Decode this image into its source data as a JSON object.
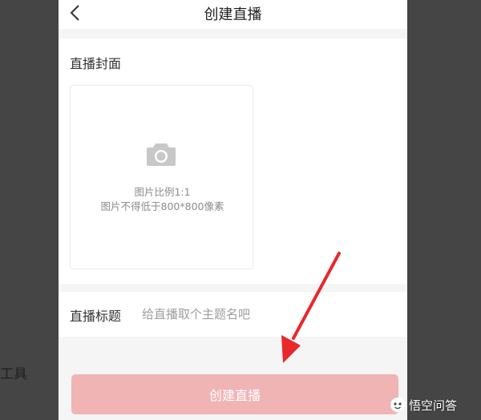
{
  "background": {
    "left_text": "工具"
  },
  "nav": {
    "title": "创建直播",
    "back_icon": "chevron-left-icon"
  },
  "cover": {
    "label": "直播封面",
    "camera_icon": "camera-icon",
    "hint_ratio": "图片比例1:1",
    "hint_size": "图片不得低于800*800像素"
  },
  "title_field": {
    "label": "直播标题",
    "placeholder": "给直播取个主题名吧",
    "value": ""
  },
  "create_button": {
    "label": "创建直播",
    "color": "#f0b4b4"
  },
  "watermark": {
    "text": "悟空问答"
  },
  "colors": {
    "arrow": "#e8282b",
    "page_bg": "#f5f5f5",
    "overlay_bg": "#454545"
  }
}
